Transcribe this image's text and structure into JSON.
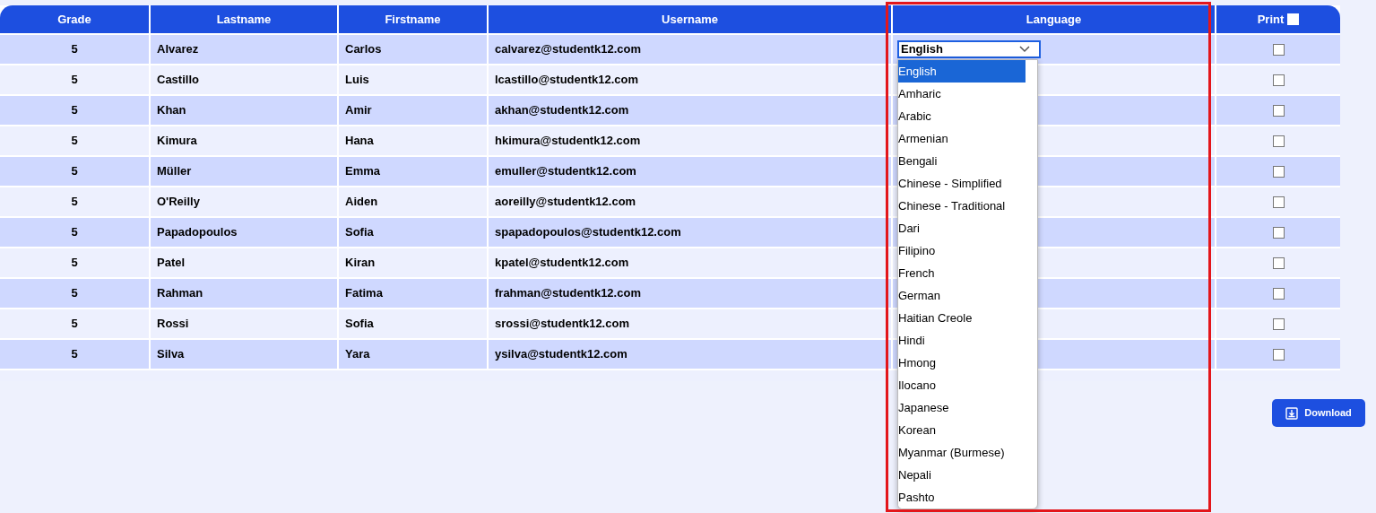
{
  "table": {
    "columns": [
      {
        "label": "Grade",
        "kind": "text"
      },
      {
        "label": "Lastname",
        "kind": "text"
      },
      {
        "label": "Firstname",
        "kind": "text"
      },
      {
        "label": "Username",
        "kind": "text"
      },
      {
        "label": "Language",
        "kind": "text"
      },
      {
        "label": "Print",
        "kind": "checkbox",
        "checked": false
      }
    ],
    "rows": [
      {
        "grade": "5",
        "lastname": "Alvarez",
        "firstname": "Carlos",
        "username": "calvarez@studentk12.com",
        "language": "English",
        "print": false
      },
      {
        "grade": "5",
        "lastname": "Castillo",
        "firstname": "Luis",
        "username": "lcastillo@studentk12.com",
        "print": false
      },
      {
        "grade": "5",
        "lastname": "Khan",
        "firstname": "Amir",
        "username": "akhan@studentk12.com",
        "print": false
      },
      {
        "grade": "5",
        "lastname": "Kimura",
        "firstname": "Hana",
        "username": "hkimura@studentk12.com",
        "print": false
      },
      {
        "grade": "5",
        "lastname": "Müller",
        "firstname": "Emma",
        "username": "emuller@studentk12.com",
        "print": false
      },
      {
        "grade": "5",
        "lastname": "O'Reilly",
        "firstname": "Aiden",
        "username": "aoreilly@studentk12.com",
        "print": false
      },
      {
        "grade": "5",
        "lastname": "Papadopoulos",
        "firstname": "Sofia",
        "username": "spapadopoulos@studentk12.com",
        "print": false
      },
      {
        "grade": "5",
        "lastname": "Patel",
        "firstname": "Kiran",
        "username": "kpatel@studentk12.com",
        "print": false
      },
      {
        "grade": "5",
        "lastname": "Rahman",
        "firstname": "Fatima",
        "username": "frahman@studentk12.com",
        "print": false
      },
      {
        "grade": "5",
        "lastname": "Rossi",
        "firstname": "Sofia",
        "username": "srossi@studentk12.com",
        "print": false
      },
      {
        "grade": "5",
        "lastname": "Silva",
        "firstname": "Yara",
        "username": "ysilva@studentk12.com",
        "print": false
      }
    ]
  },
  "language_dropdown": {
    "options": [
      {
        "label": "English",
        "selected": true
      },
      {
        "label": "Amharic",
        "selected": false
      },
      {
        "label": "Arabic",
        "selected": false
      },
      {
        "label": "Armenian",
        "selected": false
      },
      {
        "label": "Bengali",
        "selected": false
      },
      {
        "label": "Chinese - Simplified",
        "selected": false
      },
      {
        "label": "Chinese - Traditional",
        "selected": false
      },
      {
        "label": "Dari",
        "selected": false
      },
      {
        "label": "Filipino",
        "selected": false
      },
      {
        "label": "French",
        "selected": false
      },
      {
        "label": "German",
        "selected": false
      },
      {
        "label": "Haitian Creole",
        "selected": false
      },
      {
        "label": "Hindi",
        "selected": false
      },
      {
        "label": "Hmong",
        "selected": false
      },
      {
        "label": "Ilocano",
        "selected": false
      },
      {
        "label": "Japanese",
        "selected": false
      },
      {
        "label": "Korean",
        "selected": false
      },
      {
        "label": "Myanmar (Burmese)",
        "selected": false
      },
      {
        "label": "Nepali",
        "selected": false
      },
      {
        "label": "Pashto",
        "selected": false
      }
    ]
  },
  "download_button": {
    "label": "Download"
  }
}
